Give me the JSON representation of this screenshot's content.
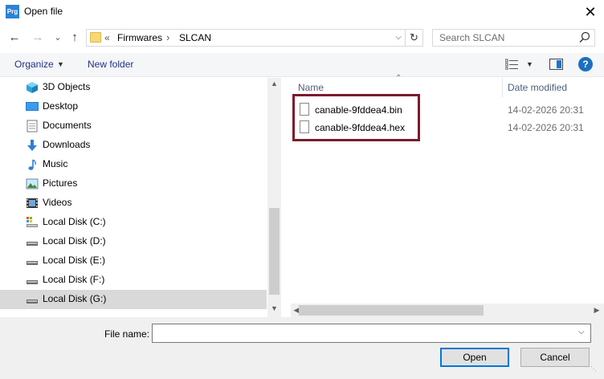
{
  "window": {
    "app_icon_text": "Prg",
    "title": "Open file",
    "close_glyph": "✕"
  },
  "nav": {
    "back_glyph": "←",
    "forward_glyph": "→",
    "recent_glyph": "⌄",
    "up_glyph": "↑",
    "breadcrumb": {
      "prefix": "«",
      "items": [
        "Firmwares",
        "SLCAN"
      ],
      "separator": "›"
    },
    "refresh_glyph": "↻",
    "search_placeholder": "Search SLCAN"
  },
  "toolbar": {
    "organize_label": "Organize",
    "new_folder_label": "New folder",
    "help_label": "?"
  },
  "sidebar": {
    "items": [
      {
        "label": "3D Objects",
        "icon": "3d-objects-icon"
      },
      {
        "label": "Desktop",
        "icon": "desktop-icon"
      },
      {
        "label": "Documents",
        "icon": "documents-icon"
      },
      {
        "label": "Downloads",
        "icon": "downloads-icon"
      },
      {
        "label": "Music",
        "icon": "music-icon"
      },
      {
        "label": "Pictures",
        "icon": "pictures-icon"
      },
      {
        "label": "Videos",
        "icon": "videos-icon"
      },
      {
        "label": "Local Disk (C:)",
        "icon": "system-drive-icon"
      },
      {
        "label": "Local Disk (D:)",
        "icon": "drive-icon"
      },
      {
        "label": "Local Disk (E:)",
        "icon": "drive-icon"
      },
      {
        "label": "Local Disk (F:)",
        "icon": "drive-icon"
      },
      {
        "label": "Local Disk (G:)",
        "icon": "drive-icon",
        "selected": true
      }
    ]
  },
  "filelist": {
    "columns": {
      "name": "Name",
      "date": "Date modified"
    },
    "files": [
      {
        "name": "canable-9fddea4.bin",
        "date": "14-02-2026 20:31"
      },
      {
        "name": "canable-9fddea4.hex",
        "date": "14-02-2026 20:31"
      }
    ],
    "highlight_color": "#7b1c2b"
  },
  "footer": {
    "file_name_label": "File name:",
    "file_name_value": "",
    "open_label": "Open",
    "cancel_label": "Cancel"
  }
}
